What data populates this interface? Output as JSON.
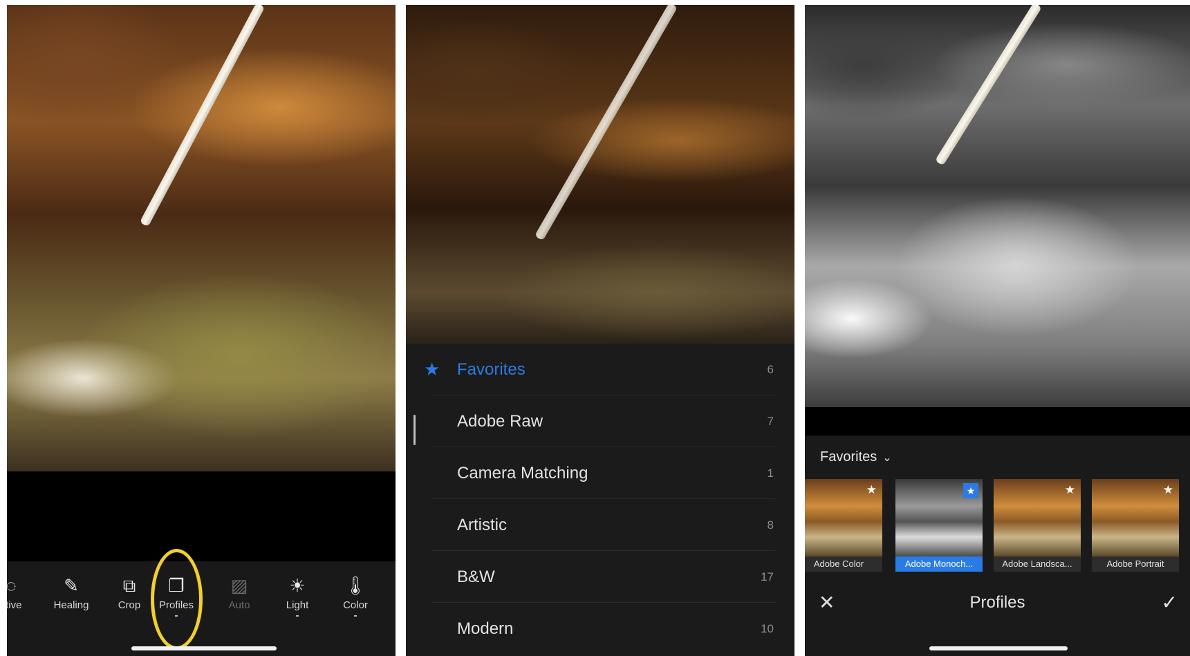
{
  "panel1": {
    "tools": [
      {
        "label": "ctive",
        "icon": "selective-icon",
        "enabled": true
      },
      {
        "label": "Healing",
        "icon": "bandage-icon",
        "enabled": true
      },
      {
        "label": "Crop",
        "icon": "crop-icon",
        "enabled": true
      },
      {
        "label": "Profiles",
        "icon": "profiles-icon",
        "enabled": true
      },
      {
        "label": "Auto",
        "icon": "auto-icon",
        "enabled": false
      },
      {
        "label": "Light",
        "icon": "sun-icon",
        "enabled": true
      },
      {
        "label": "Color",
        "icon": "thermometer-icon",
        "enabled": true
      }
    ],
    "highlight_color": "#f2cf2e"
  },
  "panel2": {
    "categories": [
      {
        "name": "Favorites",
        "count": "6",
        "active": true
      },
      {
        "name": "Adobe Raw",
        "count": "7"
      },
      {
        "name": "Camera Matching",
        "count": "1"
      },
      {
        "name": "Artistic",
        "count": "8"
      },
      {
        "name": "B&W",
        "count": "17"
      },
      {
        "name": "Modern",
        "count": "10"
      }
    ],
    "accent": "#2b7be4"
  },
  "panel3": {
    "dropdown": "Favorites",
    "profiles": [
      {
        "label": "Adobe Color",
        "selected": false
      },
      {
        "label": "Adobe Monoch...",
        "selected": true
      },
      {
        "label": "Adobe Landsca...",
        "selected": false
      },
      {
        "label": "Adobe Portrait",
        "selected": false
      }
    ],
    "title": "Profiles"
  }
}
